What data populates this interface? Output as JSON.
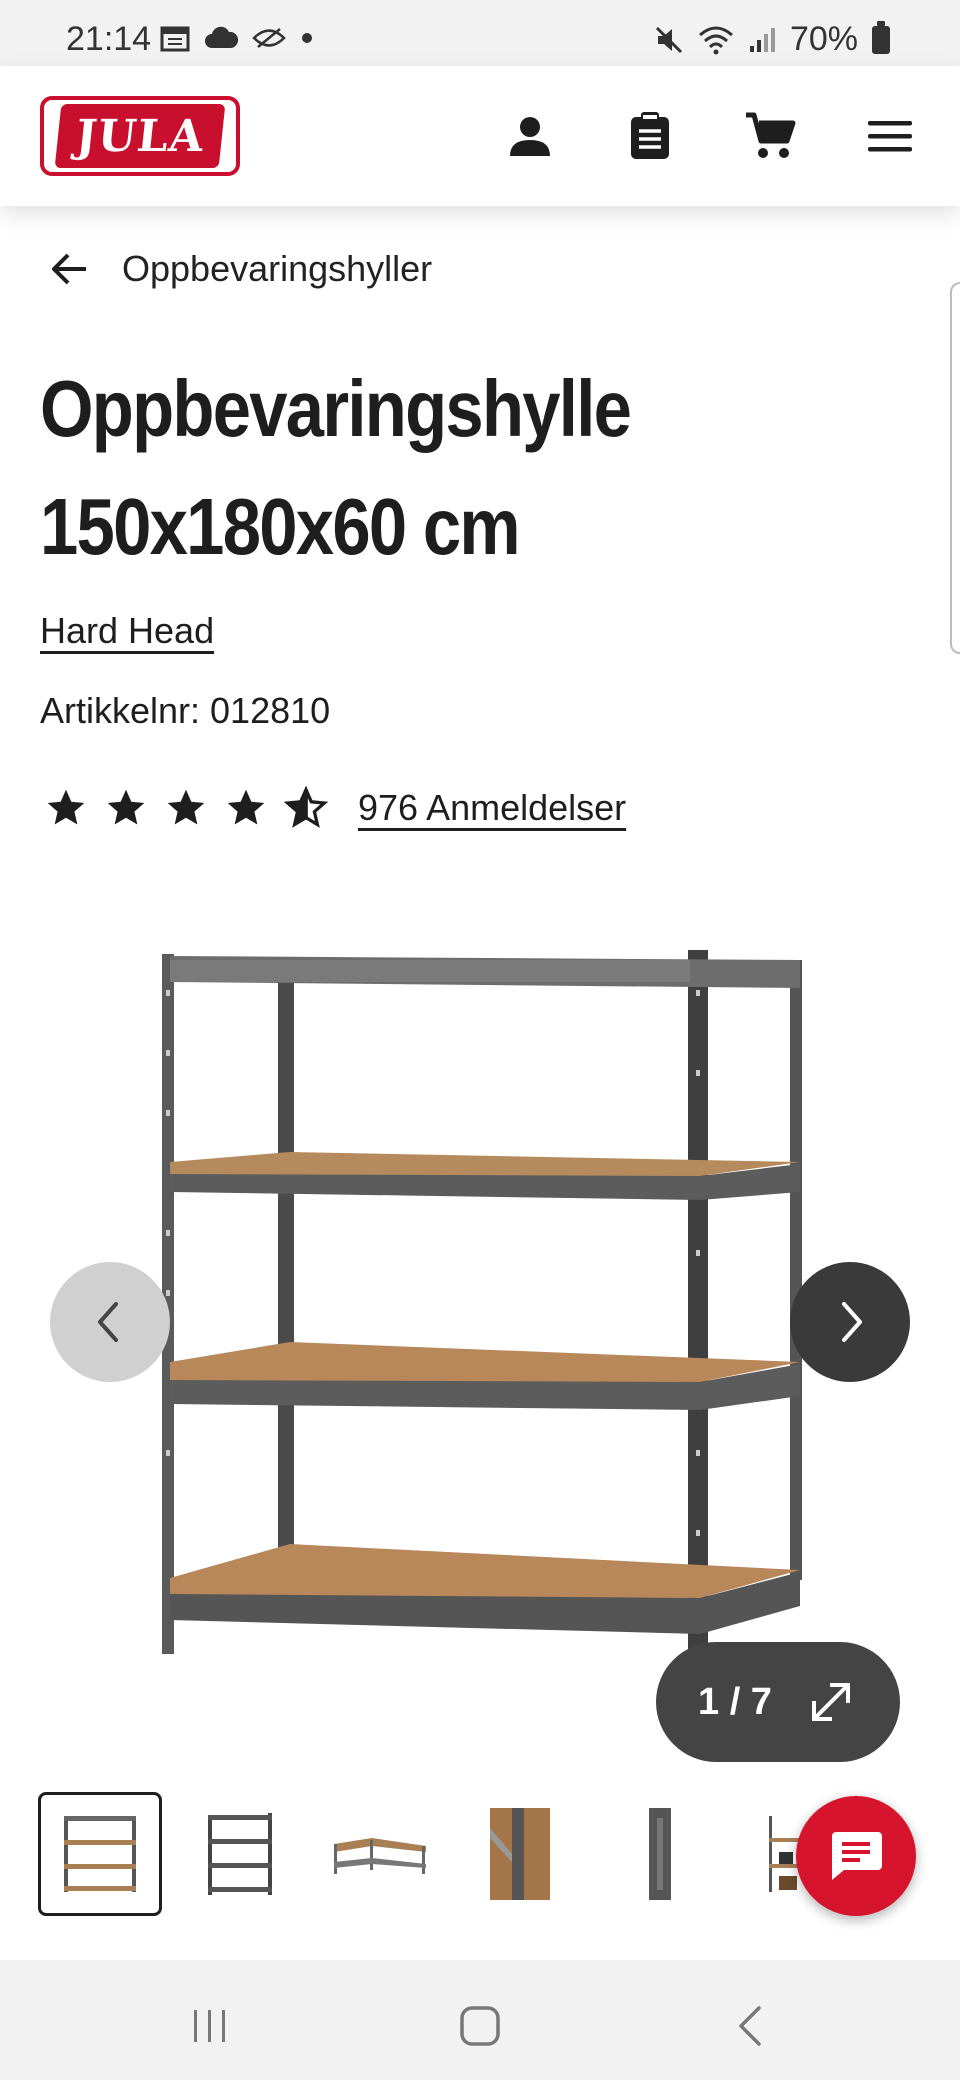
{
  "status_bar": {
    "time": "21:14",
    "battery": "70%"
  },
  "header": {
    "logo_text": "JULA",
    "icons": [
      "account-icon",
      "shopping-list-icon",
      "cart-icon",
      "menu-icon"
    ]
  },
  "breadcrumb": {
    "label": "Oppbevaringshyller"
  },
  "product": {
    "title_line1": "Oppbevaringshylle",
    "title_line2": "150x180x60 cm",
    "brand": "Hard Head",
    "article_number": "Artikkelnr: 012810",
    "rating": 4.5,
    "reviews_label": "976 Anmeldelser"
  },
  "gallery": {
    "counter": "1 / 7",
    "current_index": 1,
    "total": 7,
    "thumbnails": [
      "thumb-shelf-front",
      "thumb-shelf-angle",
      "thumb-shelf-corner",
      "thumb-shelf-detail-board",
      "thumb-shelf-upright",
      "thumb-shelf-in-use"
    ]
  },
  "colors": {
    "brand_red": "#c8102e",
    "text": "#1e1e1e",
    "counter_bg": "#444444",
    "chat_red": "#d6142d"
  }
}
